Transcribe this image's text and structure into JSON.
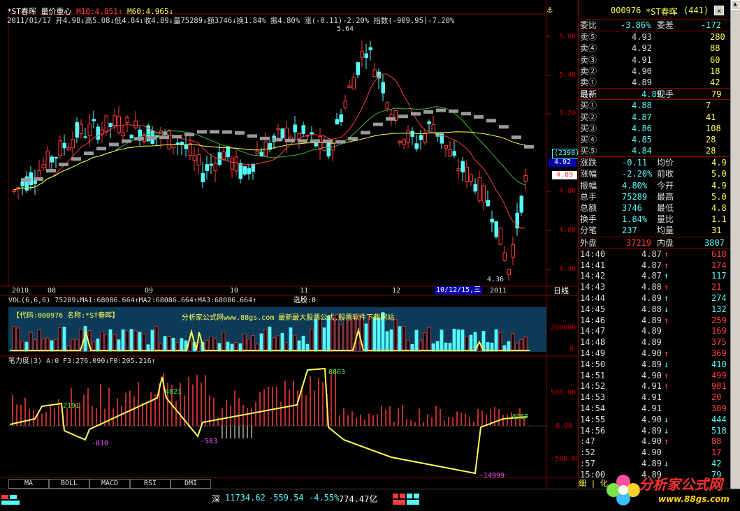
{
  "header": {
    "stock_name": "*ST春晖",
    "indicator_name": "量价重心",
    "ma10": "M10:4.851",
    "ma60": "M60:4.965",
    "ohlc_line": "2011/01/17 开4.98↓高5.08↓低4.84↓收4.89↓量75289↓额3746↓换1.84% 振4.80% 涨(-0.11)-2.20% 指数(-909.95)-7.20%"
  },
  "price_axis": {
    "labels": [
      "5.60",
      "5.40",
      "5.20",
      "4.80",
      "4.60",
      "4.40"
    ],
    "current_box": "(2398)",
    "current_price": "4.92",
    "last_price": "4.89",
    "high_label": "5.64",
    "low_label": "4.36"
  },
  "date_axis": {
    "labels": [
      "2010",
      "08",
      "09",
      "10",
      "11",
      "12",
      "2011"
    ],
    "cursor_date": "10/12/15,三",
    "period": "日线"
  },
  "vol_panel": {
    "title": "VOL(6,6,6) 75289↓MA1:68086.664↑MA2:68086.664↑MA3:68086.664↑",
    "sel": "选股:0",
    "code_text": "【代码:000976 名称:*ST春晖】",
    "watermark": "分析家公式网www.88gs.com 最新最大股票公式,股票软件下载网站",
    "axis_top": "200000",
    "axis_zero": "0"
  },
  "ind_panel": {
    "title": "笔力度(3) A:0 F3:276.090↓F0:205.216↑",
    "axis": [
      "500.00",
      "0.00",
      "-500.00"
    ],
    "labels": [
      "2191",
      "-810",
      "4821",
      "-583",
      "8863",
      "-14999",
      "4367"
    ]
  },
  "tabs": [
    "MA",
    "BOLL",
    "MACD",
    "RSI",
    "DMI"
  ],
  "status_bar": {
    "index_name": "深",
    "index_value": "11734.62",
    "change": "-559.54",
    "pct": "-4.55%",
    "amount": "774.47亿"
  },
  "logo_text": "分析家公式网",
  "logo_url": "www.88gs.com",
  "quote": {
    "code": "000976",
    "name": "*ST春晖",
    "num": "(441)",
    "wei_bi_label": "委比",
    "wei_bi": "-3.86%",
    "wei_cha_label": "委差",
    "wei_cha": "-172",
    "sells": [
      {
        "label": "卖⑤",
        "price": "4.93",
        "vol": "280"
      },
      {
        "label": "卖④",
        "price": "4.92",
        "vol": "88"
      },
      {
        "label": "卖③",
        "price": "4.91",
        "vol": "60"
      },
      {
        "label": "卖②",
        "price": "4.90",
        "vol": "18"
      },
      {
        "label": "卖①",
        "price": "4.89",
        "vol": "42"
      }
    ],
    "latest_label": "最新",
    "latest": "4.89",
    "xianshou_label": "现手",
    "xianshou": "79",
    "buys": [
      {
        "label": "买①",
        "price": "4.88",
        "vol": "7"
      },
      {
        "label": "买②",
        "price": "4.87",
        "vol": "41"
      },
      {
        "label": "买③",
        "price": "4.86",
        "vol": "108"
      },
      {
        "label": "买④",
        "price": "4.85",
        "vol": "28"
      },
      {
        "label": "买⑤",
        "price": "4.84",
        "vol": "28"
      }
    ],
    "stats": [
      {
        "l1": "涨跌",
        "v1": "-0.11",
        "l2": "均价",
        "v2": "4.9"
      },
      {
        "l1": "涨幅",
        "v1": "-2.20%",
        "l2": "前收",
        "v2": "5.0"
      },
      {
        "l1": "振幅",
        "v1": "4.80%",
        "l2": "今开",
        "v2": "4.9"
      },
      {
        "l1": "总手",
        "v1": "75289",
        "l2": "最高",
        "v2": "5.0"
      },
      {
        "l1": "总额",
        "v1": "3746",
        "l2": "最低",
        "v2": "4.8"
      },
      {
        "l1": "换手",
        "v1": "1.84%",
        "l2": "量比",
        "v2": "1.1"
      },
      {
        "l1": "分笔",
        "v1": "237",
        "l2": "均量",
        "v2": "31"
      }
    ],
    "waipan_label": "外盘",
    "waipan": "37219",
    "neipan_label": "内盘",
    "neipan": "3807",
    "trades": [
      {
        "t": "14:40",
        "p": "4.87",
        "a": "↑",
        "v": "618",
        "c": "r"
      },
      {
        "t": "14:41",
        "p": "4.87",
        "a": "↑",
        "v": "174",
        "c": "r"
      },
      {
        "t": "14:42",
        "p": "4.87",
        "a": "↑",
        "v": "117",
        "c": "g"
      },
      {
        "t": "14:43",
        "p": "4.88",
        "a": "↑",
        "v": "21",
        "c": "r"
      },
      {
        "t": "14:44",
        "p": "4.89",
        "a": "↑",
        "v": "274",
        "c": "g"
      },
      {
        "t": "14:45",
        "p": "4.88",
        "a": "↓",
        "v": "132",
        "c": "g"
      },
      {
        "t": "14:46",
        "p": "4.89",
        "a": "↑",
        "v": "259",
        "c": "r"
      },
      {
        "t": "14:47",
        "p": "4.89",
        "a": "",
        "v": "169",
        "c": "r"
      },
      {
        "t": "14:48",
        "p": "4.89",
        "a": "",
        "v": "375",
        "c": "r"
      },
      {
        "t": "14:49",
        "p": "4.90",
        "a": "↑",
        "v": "369",
        "c": "r"
      },
      {
        "t": "14:50",
        "p": "4.89",
        "a": "↓",
        "v": "410",
        "c": "g"
      },
      {
        "t": "14:51",
        "p": "4.90",
        "a": "↑",
        "v": "499",
        "c": "r"
      },
      {
        "t": "14:52",
        "p": "4.91",
        "a": "↑",
        "v": "981",
        "c": "r"
      },
      {
        "t": "14:53",
        "p": "4.91",
        "a": "",
        "v": "20",
        "c": "r"
      },
      {
        "t": "14:54",
        "p": "4.91",
        "a": "",
        "v": "309",
        "c": "r"
      },
      {
        "t": "14:55",
        "p": "4.90",
        "a": "↓",
        "v": "444",
        "c": "g"
      },
      {
        "t": "14:56",
        "p": "4.89",
        "a": "↓",
        "v": "518",
        "c": "g"
      },
      {
        "t": ":47",
        "p": "4.90",
        "a": "↑",
        "v": "88",
        "c": "r"
      },
      {
        "t": ":52",
        "p": "4.90",
        "a": "",
        "v": "17",
        "c": "r"
      },
      {
        "t": ":57",
        "p": "4.89",
        "a": "↓",
        "v": "42",
        "c": "g"
      },
      {
        "t": "15:00",
        "p": "4.89",
        "a": "",
        "v": "79",
        "c": "g"
      }
    ],
    "footer": "细 | 化"
  },
  "colors": {
    "up": "#ff3c3c",
    "down": "#54fcfc",
    "ma10": "#ff3c3c",
    "ma60": "#ffff54",
    "gray": "#9a9a9a",
    "green": "#3cb93c",
    "frame": "#800000",
    "axis": "#c80000"
  }
}
